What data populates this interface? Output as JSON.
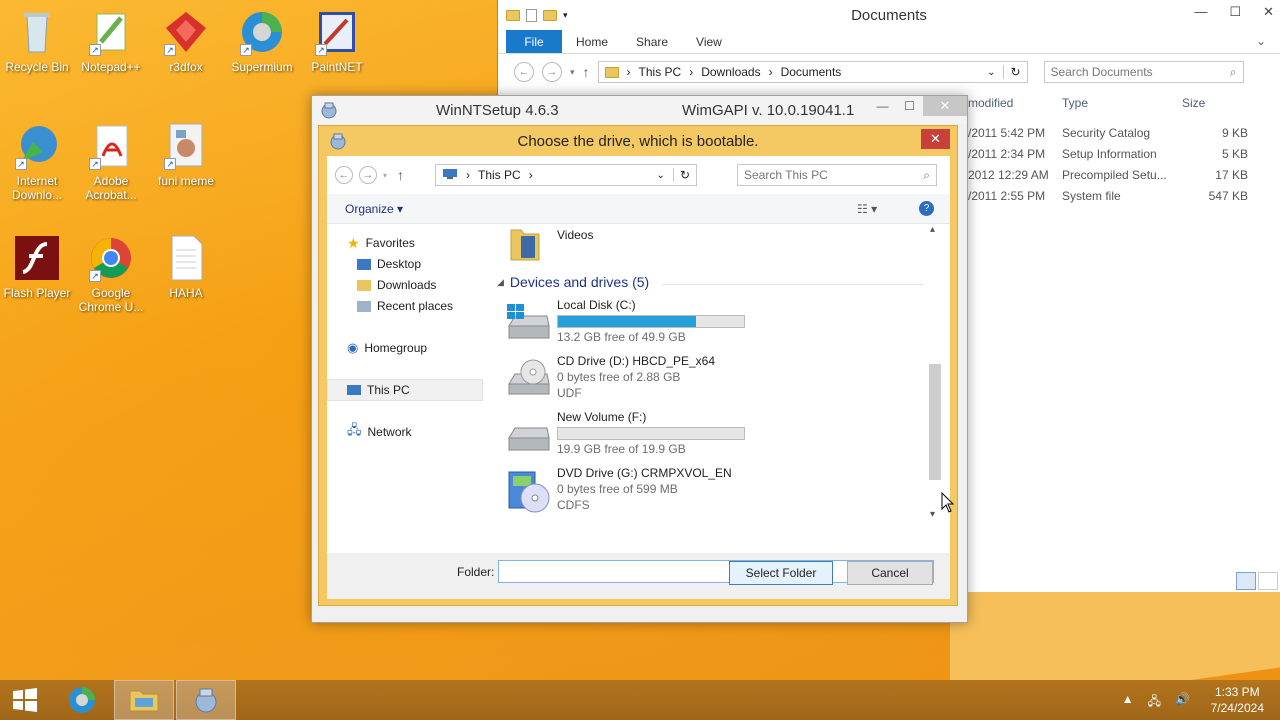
{
  "desktop": {
    "icons": [
      {
        "label": "Recycle Bin"
      },
      {
        "label": "Notepad++"
      },
      {
        "label": "r3dfox"
      },
      {
        "label": "Supermium"
      },
      {
        "label": "PaintNET"
      },
      {
        "label": "Internet Downlo..."
      },
      {
        "label": "Adobe Acrobat..."
      },
      {
        "label": "funi meme"
      },
      {
        "label": "Flash Player"
      },
      {
        "label": "Google Chrome U..."
      },
      {
        "label": "HAHA"
      }
    ]
  },
  "explorer": {
    "title": "Documents",
    "tabs": [
      "File",
      "Home",
      "Share",
      "View"
    ],
    "path": [
      "This PC",
      "Downloads",
      "Documents"
    ],
    "search_placeholder": "Search Documents",
    "columns": {
      "modified": "modified",
      "type": "Type",
      "size": "Size"
    },
    "rows": [
      {
        "date": "/2011 5:42 PM",
        "type": "Security Catalog",
        "size": "9 KB"
      },
      {
        "date": "/2011 2:34 PM",
        "type": "Setup Information",
        "size": "5 KB"
      },
      {
        "date": "2012 12:29 AM",
        "type": "Precompiled Setu...",
        "size": "17 KB"
      },
      {
        "date": "/2011 2:55 PM",
        "type": "System file",
        "size": "547 KB"
      }
    ]
  },
  "winntsetup": {
    "title": "WinNTSetup 4.6.3",
    "api": "WimGAPI v. 10.0.19041.1"
  },
  "dialog": {
    "title": "Choose the drive, which is bootable.",
    "address": "This PC",
    "search_placeholder": "Search This PC",
    "organize": "Organize",
    "nav": {
      "favorites": "Favorites",
      "desktop": "Desktop",
      "downloads": "Downloads",
      "recent": "Recent places",
      "homegroup": "Homegroup",
      "this_pc": "This PC",
      "network": "Network"
    },
    "videos": "Videos",
    "group_header": "Devices and drives (5)",
    "drives": [
      {
        "name": "Local Disk (C:)",
        "free": "13.2 GB free of 49.9 GB",
        "fs": "",
        "used_fraction": 0.74
      },
      {
        "name": "CD Drive (D:) HBCD_PE_x64",
        "free": "0 bytes free of 2.88 GB",
        "fs": "UDF"
      },
      {
        "name": "New Volume (F:)",
        "free": "19.9 GB free of 19.9 GB",
        "fs": "",
        "used_fraction": 0.0
      },
      {
        "name": "DVD Drive (G:) CRMPXVOL_EN",
        "free": "0 bytes free of 599 MB",
        "fs": "CDFS"
      }
    ],
    "folder_label": "Folder:",
    "folder_value": "",
    "select_button": "Select Folder",
    "cancel_button": "Cancel"
  },
  "taskbar": {
    "time": "1:33 PM",
    "date": "7/24/2024"
  },
  "colors": {
    "accent": "#1979ca",
    "drive_bar": "#26a0da",
    "dialog_frame": "#f4c963",
    "close_red": "#c7413a"
  }
}
